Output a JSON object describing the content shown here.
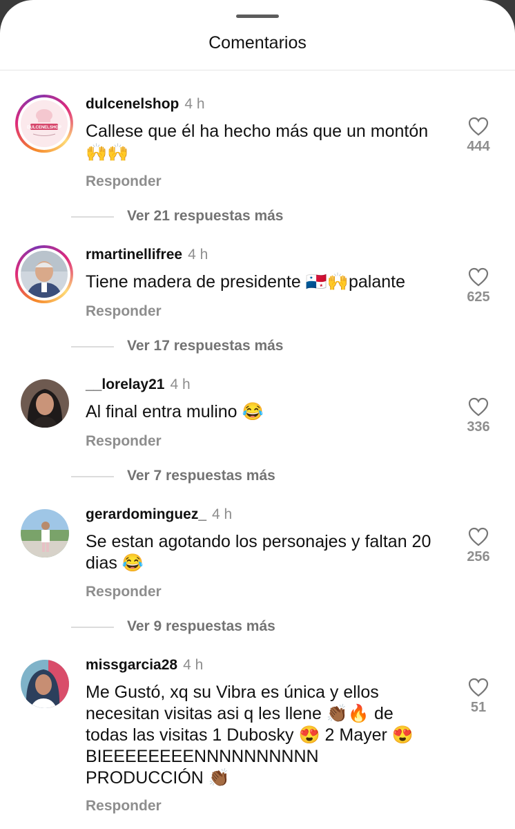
{
  "sheet": {
    "title": "Comentarios"
  },
  "comments": [
    {
      "username": "dulcenelshop",
      "time": "4 h",
      "text": "Callese que él ha hecho más que un montón 🙌🙌",
      "reply": "Responder",
      "likes": "444",
      "more_replies": "Ver 21 respuestas más",
      "avatar_text": "DULCENELSHOP"
    },
    {
      "username": "rmartinellifree",
      "time": "4 h",
      "text": "Tiene madera de presidente 🇵🇦🙌palante",
      "reply": "Responder",
      "likes": "625",
      "more_replies": "Ver 17 respuestas más"
    },
    {
      "username": "__lorelay21",
      "time": "4 h",
      "text": "Al final entra mulino 😂",
      "reply": "Responder",
      "likes": "336",
      "more_replies": "Ver 7 respuestas más"
    },
    {
      "username": "gerardominguez_",
      "time": "4 h",
      "text": "Se estan agotando los personajes y faltan 20 dias 😂",
      "reply": "Responder",
      "likes": "256",
      "more_replies": "Ver 9 respuestas más"
    },
    {
      "username": "missgarcia28",
      "time": "4 h",
      "text": "Me Gustó, xq su Vibra es única y ellos necesitan visitas asi q les llene 👏🏾🔥 de todas las visitas 1 Dubosky 😍 2 Mayer 😍  BIEEEEEEEENNNNNNNNNN PRODUCCIÓN 👏🏾",
      "reply": "Responder",
      "likes": "51"
    }
  ]
}
